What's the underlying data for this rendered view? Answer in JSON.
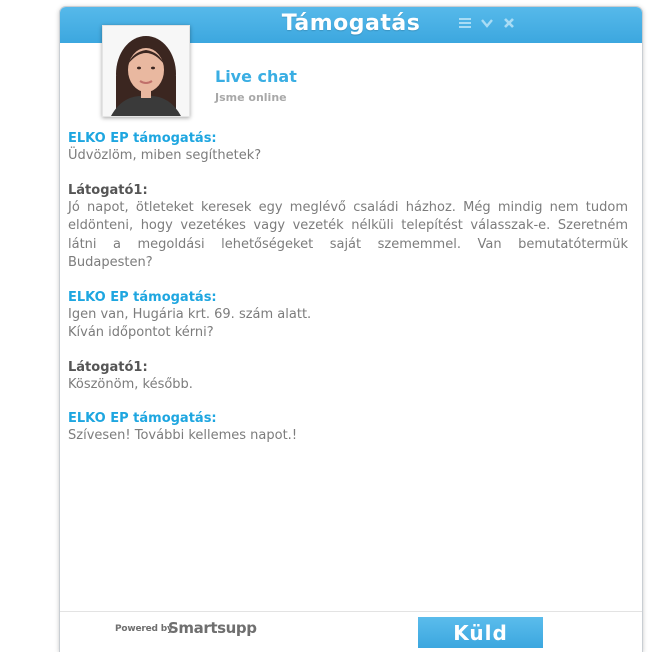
{
  "header": {
    "title": "Támogatás",
    "controls": [
      "menu-icon",
      "chevron-down-icon",
      "close-icon"
    ]
  },
  "agent": {
    "title": "Live chat",
    "status": "Jsme online"
  },
  "messages": [
    {
      "sender": "ELKO EP támogatás:",
      "role": "support",
      "lines": [
        "Üdvözlöm, miben segíthetek?"
      ]
    },
    {
      "sender": "Látogató1:",
      "role": "visitor",
      "lines": [
        "Jó napot, ötleteket keresek egy meglévő családi házhoz. Még mindig nem tudom eldönteni, hogy vezetékes vagy vezeték nélküli telepítést válasszak-e. Szeretném látni a megoldási lehetőségeket saját szememmel. Van bemutatótermük Budapesten?"
      ]
    },
    {
      "sender": "ELKO EP támogatás:",
      "role": "support",
      "lines": [
        "Igen van, Hugária krt. 69. szám alatt.",
        "Kíván időpontot kérni?"
      ]
    },
    {
      "sender": "Látogató1:",
      "role": "visitor",
      "lines": [
        "Köszönöm, később."
      ]
    },
    {
      "sender": "ELKO EP támogatás:",
      "role": "support",
      "lines": [
        "Szívesen! További kellemes napot.!"
      ]
    }
  ],
  "footer": {
    "powered_by": "Powered by",
    "brand": "Smartsupp",
    "send_label": "Küld"
  },
  "colors": {
    "accent": "#3ca7df",
    "support_sender": "#1ea6e0",
    "visitor_sender": "#555555",
    "message_text": "#7c7c7c"
  }
}
